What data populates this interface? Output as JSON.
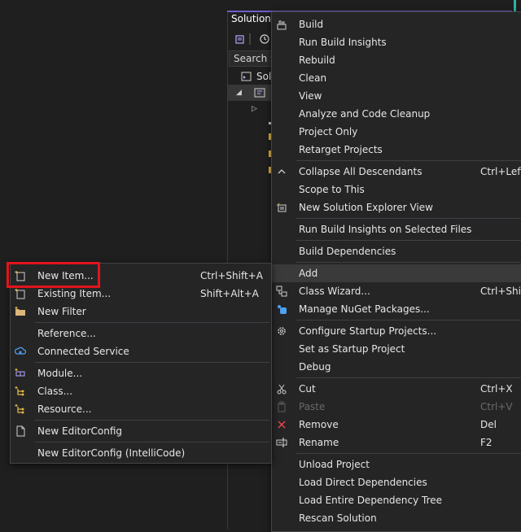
{
  "solution_explorer": {
    "title": "Solution",
    "search_placeholder": "Search S",
    "solution_node": "Solu"
  },
  "context_menu": {
    "build": "Build",
    "run_build_insights": "Run Build Insights",
    "rebuild": "Rebuild",
    "clean": "Clean",
    "view": "View",
    "analyze": "Analyze and Code Cleanup",
    "project_only": "Project Only",
    "retarget": "Retarget Projects",
    "collapse_all": "Collapse All Descendants",
    "collapse_all_shortcut": "Ctrl+Left",
    "scope_to_this": "Scope to This",
    "new_se_view": "New Solution Explorer View",
    "run_bi_selected": "Run Build Insights on Selected Files",
    "build_dependencies": "Build Dependencies",
    "add": "Add",
    "class_wizard": "Class Wizard...",
    "class_wizard_shortcut": "Ctrl+Shift",
    "manage_nuget": "Manage NuGet Packages...",
    "configure_startup": "Configure Startup Projects...",
    "set_startup": "Set as Startup Project",
    "debug": "Debug",
    "cut": "Cut",
    "cut_shortcut": "Ctrl+X",
    "paste": "Paste",
    "paste_shortcut": "Ctrl+V",
    "remove": "Remove",
    "remove_shortcut": "Del",
    "rename": "Rename",
    "rename_shortcut": "F2",
    "unload_project": "Unload Project",
    "load_direct": "Load Direct Dependencies",
    "load_entire": "Load Entire Dependency Tree",
    "rescan": "Rescan Solution"
  },
  "add_submenu": {
    "new_item": "New Item...",
    "new_item_shortcut": "Ctrl+Shift+A",
    "existing_item": "Existing Item...",
    "existing_item_shortcut": "Shift+Alt+A",
    "new_filter": "New Filter",
    "reference": "Reference...",
    "connected_service": "Connected Service",
    "module": "Module...",
    "class": "Class...",
    "resource": "Resource...",
    "new_editorconfig": "New EditorConfig",
    "new_editorconfig_intellicode": "New EditorConfig (IntelliCode)"
  },
  "colors": {
    "menu_background": "#252526",
    "highlight": "#3a3a3a",
    "focus_outline": "#e3141b",
    "accent": "#6c5fc7"
  }
}
